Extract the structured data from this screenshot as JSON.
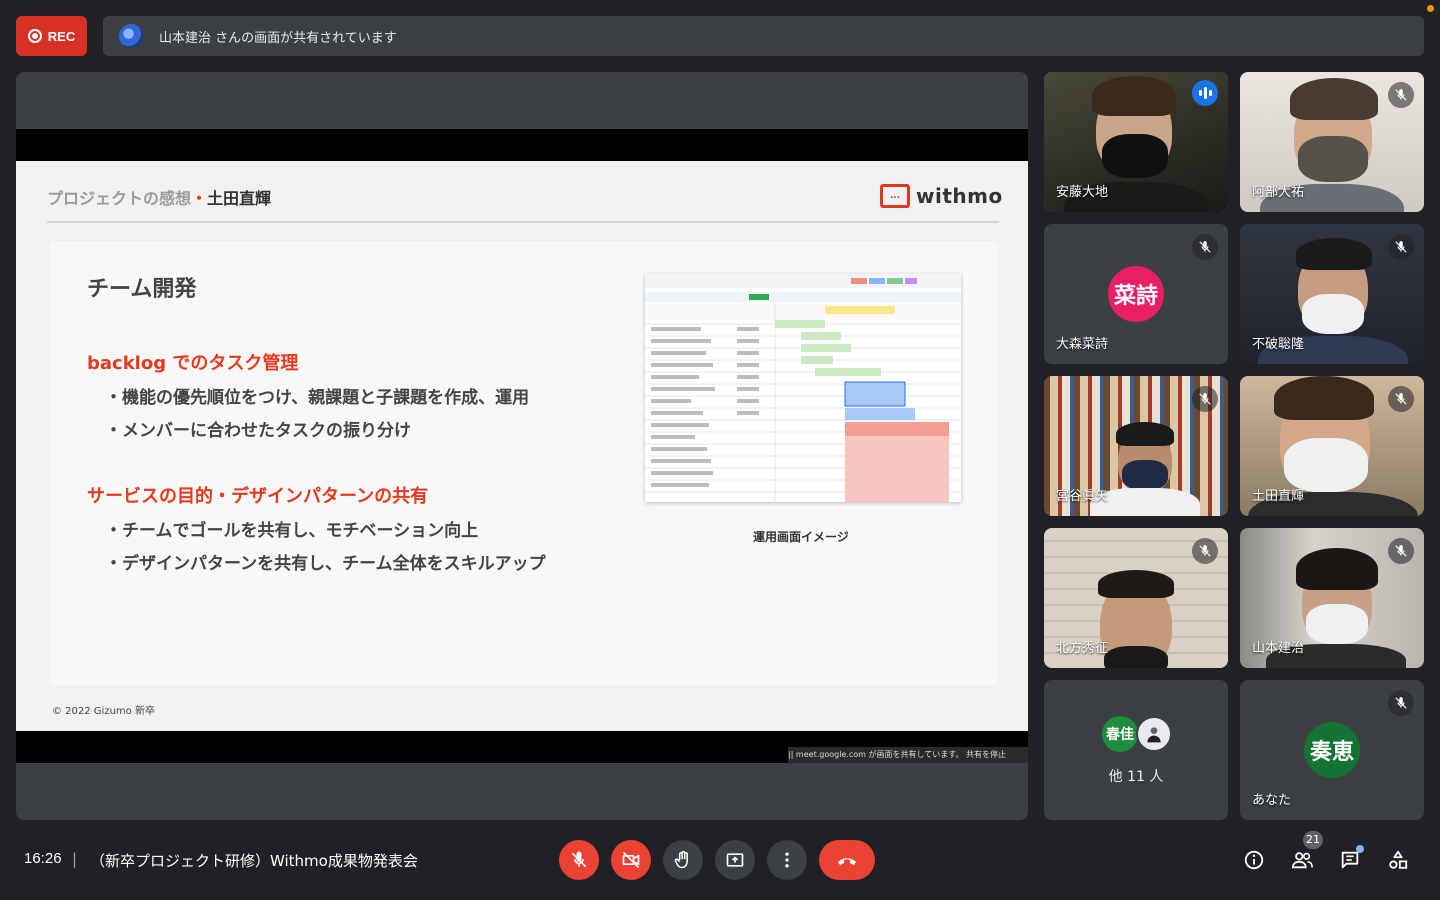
{
  "recording": {
    "label": "REC"
  },
  "share_banner": {
    "text": "山本建治 さんの画面が共有されています"
  },
  "slide": {
    "header_prefix": "プロジェクトの感想",
    "header_dot": "・",
    "header_name": "土田直輝",
    "logo_icon": "...",
    "logo_text": "withmo",
    "card_title": "チーム開発",
    "section1": {
      "title": "backlog でのタスク管理",
      "bullets": [
        "・機能の優先順位をつけ、親課題と子課題を作成、運用",
        "・メンバーに合わせたタスクの振り分け"
      ]
    },
    "section2": {
      "title": "サービスの目的・デザインパターンの共有",
      "bullets": [
        "・チームでゴールを共有し、モチベーション向上",
        "・デザインパターンを共有し、チーム全体をスキルアップ"
      ]
    },
    "image_caption": "運用画面イメージ",
    "copyright": "© 2022  Gizumo 新卒"
  },
  "screen_share_tip": "|| meet.google.com が画面を共有しています。    共有を停止",
  "participants": [
    {
      "name": "安藤大地",
      "state": "speaking"
    },
    {
      "name": "阿部大祐",
      "state": "muted"
    },
    {
      "name": "大森菜詩",
      "state": "muted",
      "avatar_text": "菜詩",
      "avatar_color": "#e91e63"
    },
    {
      "name": "不破聡隆",
      "state": "muted"
    },
    {
      "name": "宮谷眞矢",
      "state": "muted"
    },
    {
      "name": "土田直輝",
      "state": "muted"
    },
    {
      "name": "北方秀征",
      "state": "muted"
    },
    {
      "name": "山本建治",
      "state": "muted"
    },
    {
      "name": "他 11 人",
      "state": "group",
      "avatar_text": "春佳",
      "avatar_color": "#1e8e3e"
    },
    {
      "name": "あなた",
      "state": "muted",
      "avatar_text": "奏恵",
      "avatar_color": "#137333"
    }
  ],
  "bottom_bar": {
    "time": "16:26",
    "separator": "|",
    "meeting_title": "（新卒プロジェクト研修）Withmo成果物発表会",
    "people_count": "21"
  },
  "colors": {
    "accent": "#8ab4f8",
    "danger": "#ea4335",
    "slide_red": "#e5391e"
  }
}
